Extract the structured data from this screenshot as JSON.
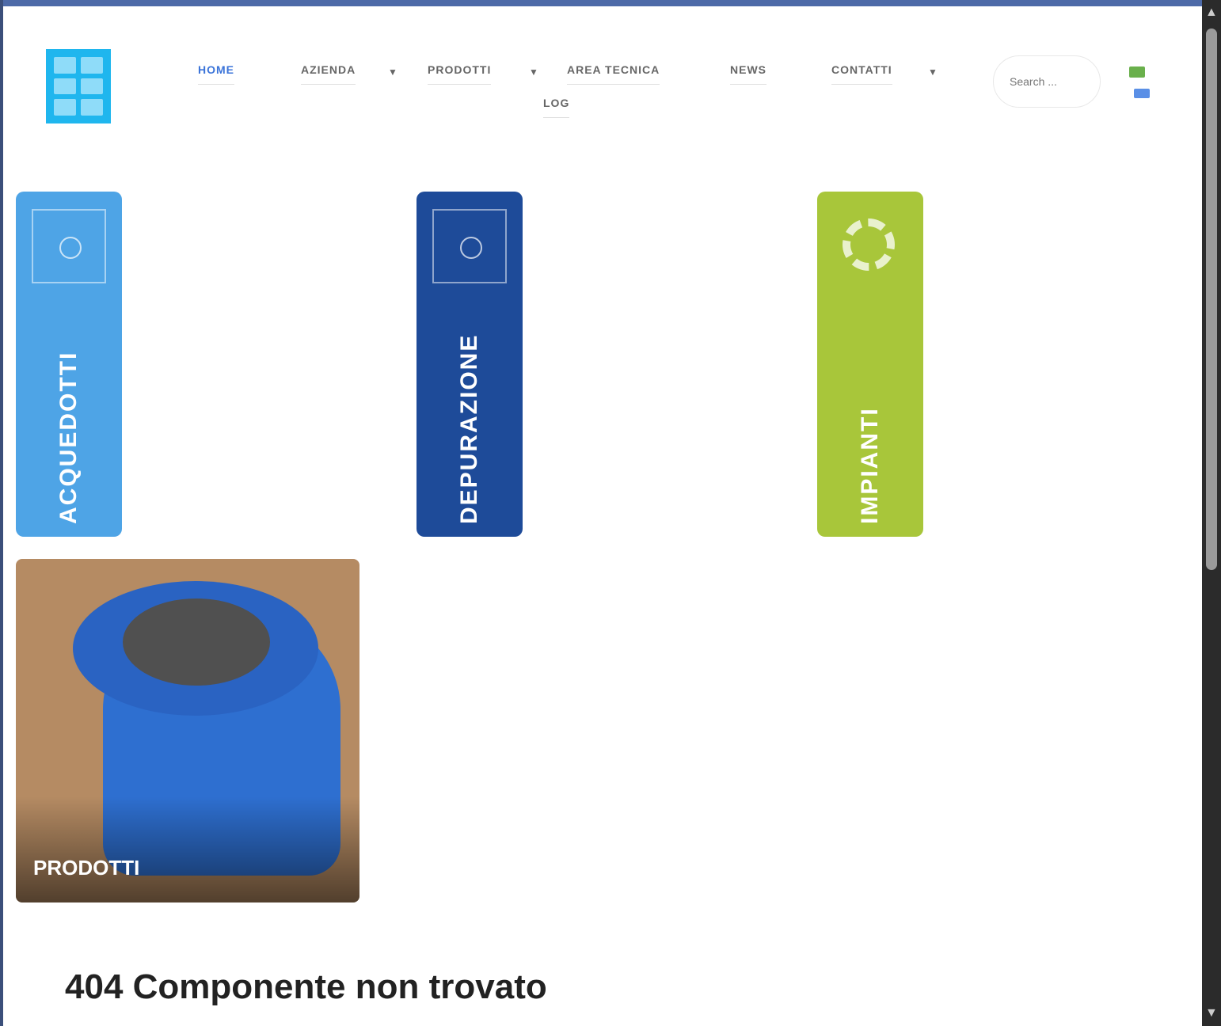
{
  "header": {
    "nav": [
      {
        "label": "HOME",
        "active": true
      },
      {
        "label": "AZIENDA",
        "has_caret": true
      },
      {
        "label": "PRODOTTI",
        "has_caret": true
      },
      {
        "label": "AREA TECNICA"
      },
      {
        "label": "NEWS"
      },
      {
        "label": "CONTATTI",
        "has_caret": true
      },
      {
        "label": "LOG"
      }
    ],
    "search_placeholder": "Search ..."
  },
  "cards": [
    {
      "label": "ACQUEDOTTI",
      "color": "#4ea4e6",
      "icon": "pipe-flange-icon"
    },
    {
      "label": "DEPURAZIONE",
      "color": "#1e4b99",
      "icon": "valve-icon"
    },
    {
      "label": "IMPIANTI",
      "color": "#a8c63a",
      "icon": "gear-icon"
    }
  ],
  "product": {
    "label": "PRODOTTI"
  },
  "error": {
    "title": "404 Componente non trovato"
  }
}
